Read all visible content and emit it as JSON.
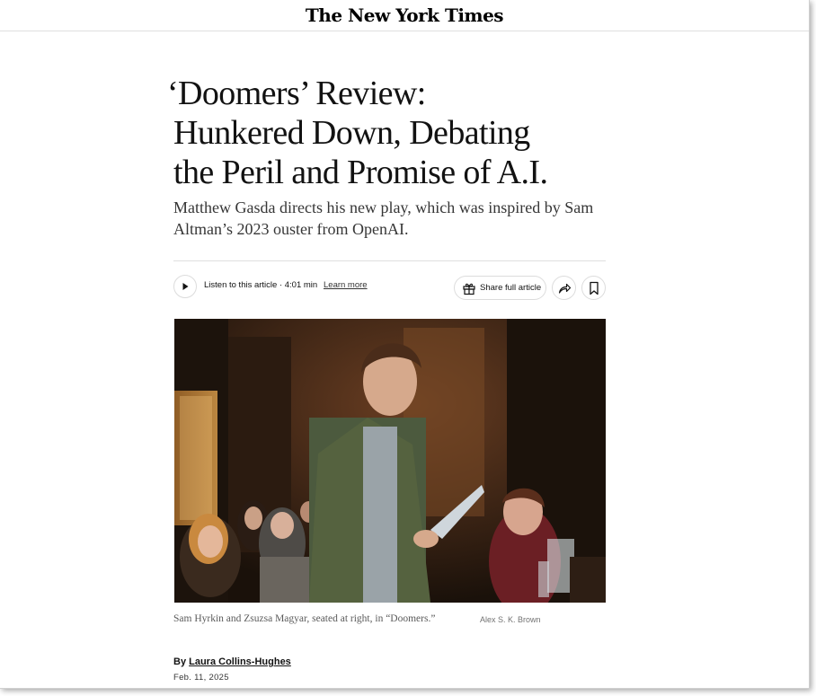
{
  "masthead": {
    "logo_text": "The New York Times"
  },
  "article": {
    "headline_lines": [
      "‘Doomers’ Review:",
      "Hunkered Down, Debating",
      "the Peril and Promise of A.I."
    ],
    "summary": "Matthew Gasda directs his new play, which was inspired by Sam Altman’s 2023 ouster from OpenAI.",
    "toolbar": {
      "listen_label": "Listen to this article · 4:01 min",
      "learn_more": "Learn more",
      "share_label": "Share full article"
    },
    "photo": {
      "caption": "Sam Hyrkin and Zsuzsa Magyar, seated at right, in “Doomers.”",
      "credit": "Alex S. K. Brown"
    },
    "byline": {
      "prefix": "By",
      "author": "Laura Collins-Hughes"
    },
    "date": "Feb. 11, 2025"
  },
  "icons": {
    "play": "play-icon",
    "gift": "gift-icon",
    "share": "share-arrow-icon",
    "bookmark": "bookmark-icon"
  }
}
